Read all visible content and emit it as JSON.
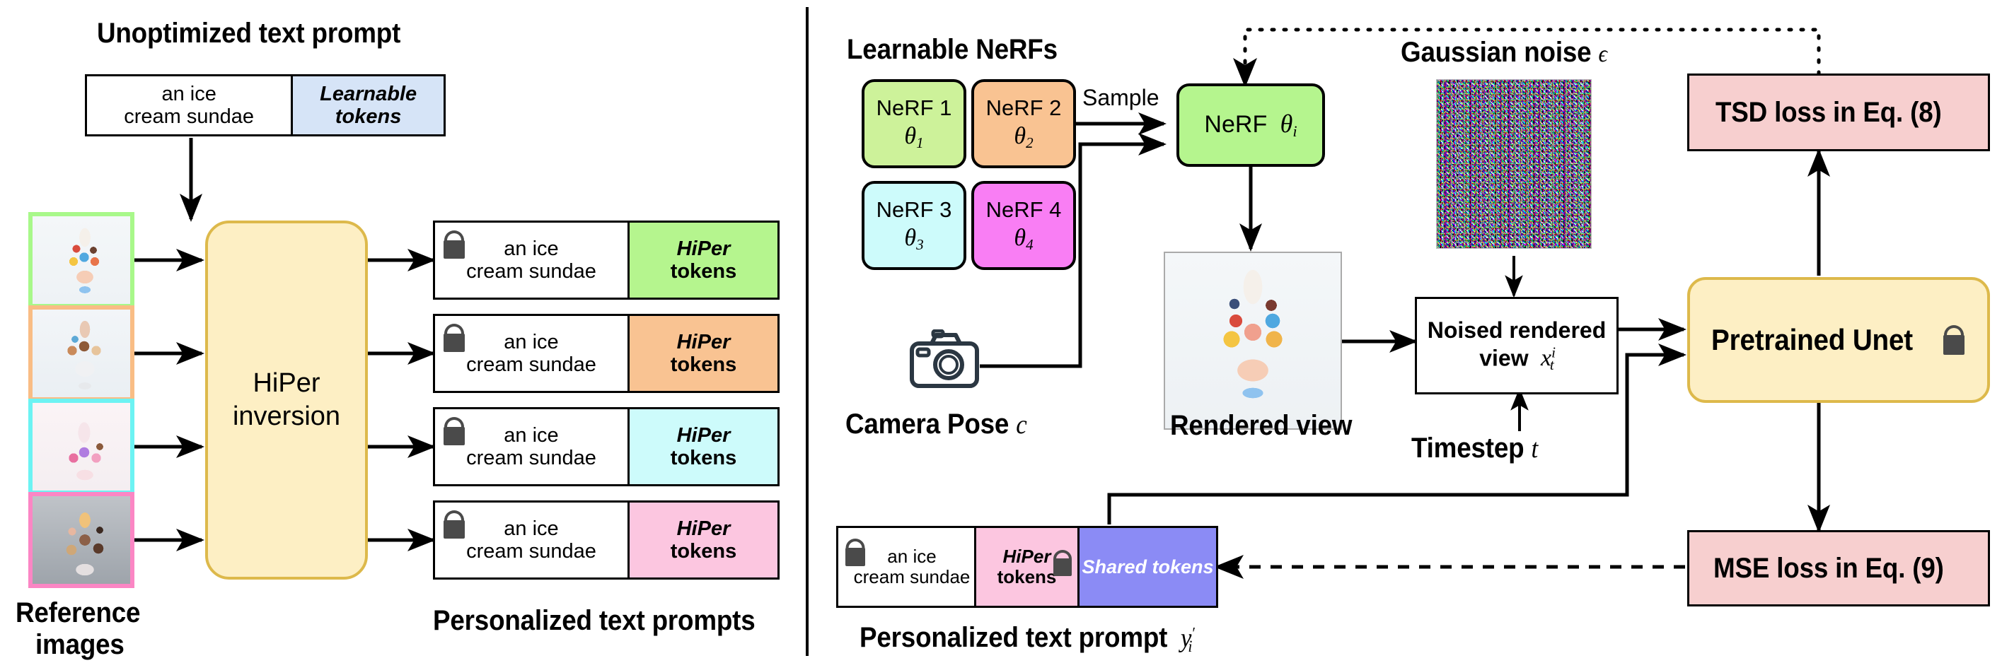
{
  "left_panel": {
    "title": "Unoptimized text prompt",
    "prompt_box": {
      "text": "an ice\ncream sundae",
      "learnable_label_line1": "Learnable",
      "learnable_label_line2": "tokens",
      "learnable_color": "#d6e4f7"
    },
    "module": {
      "label_line1": "HiPer",
      "label_line2": "inversion",
      "fill": "#fdefc4",
      "border": "#ddb94b"
    },
    "reference_images_label_line1": "Reference",
    "reference_images_label_line2": "images",
    "reference_images": [
      {
        "border": "#a8f88a",
        "name": "sundae-green"
      },
      {
        "border": "#f9bd85",
        "name": "sundae-orange"
      },
      {
        "border": "#6cf3f3",
        "name": "sundae-cyan"
      },
      {
        "border": "#fb86c4",
        "name": "sundae-pink"
      }
    ],
    "personalized_prompts_label": "Personalized text prompts",
    "personalized_prompts": [
      {
        "text": "an ice\ncream sundae",
        "token_italic": "HiPer",
        "token_bold": "tokens",
        "fill": "#b5f58e"
      },
      {
        "text": "an ice\ncream sundae",
        "token_italic": "HiPer",
        "token_bold": "tokens",
        "fill": "#f9c392"
      },
      {
        "text": "an ice\ncream sundae",
        "token_italic": "HiPer",
        "token_bold": "tokens",
        "fill": "#cdfbfb"
      },
      {
        "text": "an ice\ncream sundae",
        "token_italic": "HiPer",
        "token_bold": "tokens",
        "fill": "#fcc6e0"
      }
    ]
  },
  "right_panel": {
    "learnable_nerfs_title": "Learnable NeRFs",
    "nerfs": [
      {
        "label": "NeRF 1",
        "theta": "θ",
        "sub": "1",
        "fill": "#cdf29a"
      },
      {
        "label": "NeRF 2",
        "theta": "θ",
        "sub": "2",
        "fill": "#f9c392"
      },
      {
        "label": "NeRF 3",
        "theta": "θ",
        "sub": "3",
        "fill": "#cdfbfb"
      },
      {
        "label": "NeRF 4",
        "theta": "θ",
        "sub": "4",
        "fill": "#f97ef4"
      }
    ],
    "sample_label": "Sample",
    "sampled_nerf": {
      "label": "NeRF",
      "theta": "θ",
      "sub": "i",
      "fill": "#b5f58e"
    },
    "camera_pose_label": "Camera Pose",
    "camera_pose_symbol": "c",
    "rendered_view_label": "Rendered view",
    "gaussian_noise_label": "Gaussian noise",
    "gaussian_noise_symbol": "ϵ",
    "noised_view_line1": "Noised rendered",
    "noised_view_line2": "view",
    "noised_view_symbol": "x",
    "noised_view_sup": "i",
    "noised_view_sub": "t",
    "timestep_label": "Timestep",
    "timestep_symbol": "t",
    "unet_label": "Pretrained Unet",
    "unet_fill": "#fdefc4",
    "unet_border": "#ddb94b",
    "tsd_loss_label": "TSD loss in Eq. (8)",
    "mse_loss_label": "MSE loss in Eq. (9)",
    "loss_fill": "#f7cfcf",
    "bottom_prompt": {
      "text": "an ice\ncream sundae",
      "hiper_italic": "HiPer",
      "hiper_bold": "tokens",
      "hiper_fill": "#fcc6e0",
      "shared_label": "Shared tokens",
      "shared_fill": "#8b8bf5"
    },
    "bottom_prompt_caption": "Personalized text prompt",
    "bottom_prompt_symbol": "y",
    "bottom_prompt_sub": "i"
  },
  "icons": {
    "lock": "lock-icon",
    "camera": "camera-icon"
  }
}
